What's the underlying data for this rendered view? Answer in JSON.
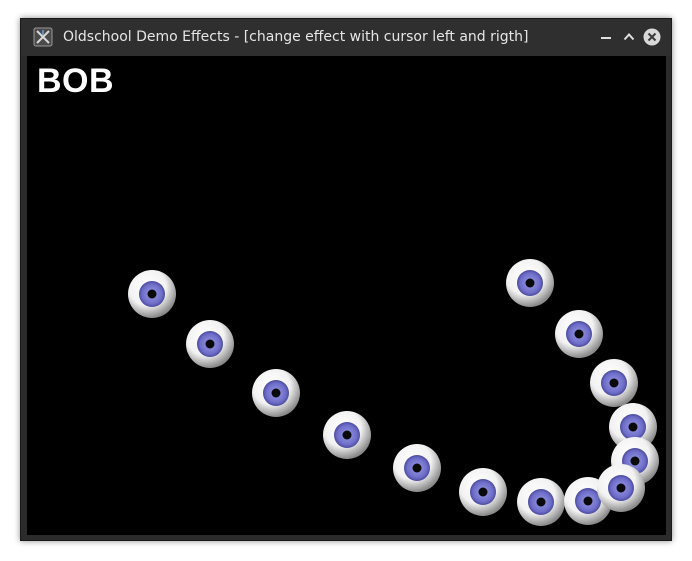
{
  "window": {
    "title": "Oldschool Demo Effects - [change effect with cursor left and rigth]",
    "controls": [
      "minimize",
      "maximize",
      "close"
    ]
  },
  "canvas": {
    "effect_name": "BOB",
    "background": "#000000",
    "sprite_icon": "eyeball-icon",
    "sprite_colors": {
      "sclera": "#f2f2f2",
      "iris": "#6d6dc8",
      "pupil": "#0a0a0a"
    },
    "bob_count": 14
  }
}
